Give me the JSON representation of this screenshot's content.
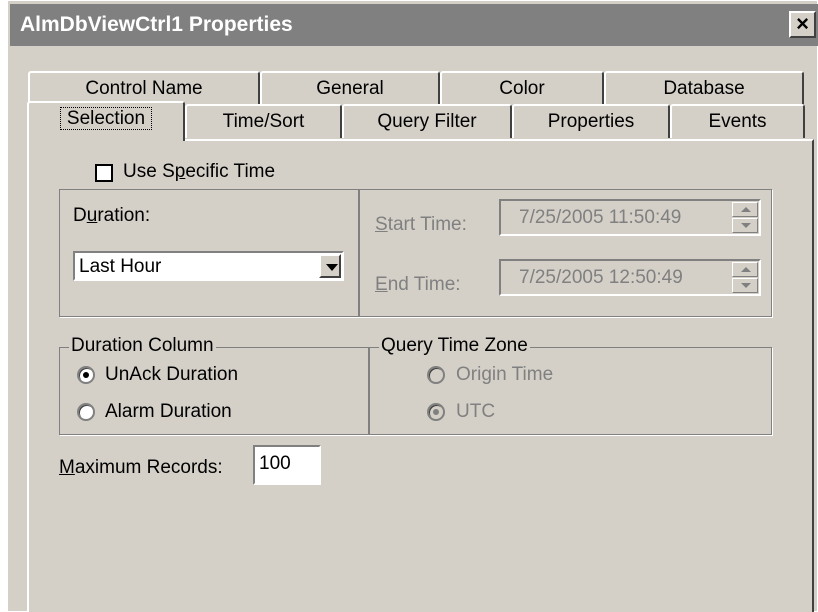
{
  "window": {
    "title": "AlmDbViewCtrl1 Properties",
    "close_glyph": "×"
  },
  "tabs": {
    "row1": [
      "Control Name",
      "General",
      "Color",
      "Database"
    ],
    "row2": [
      "Selection",
      "Time/Sort",
      "Query Filter",
      "Properties",
      "Events"
    ],
    "active": "Selection"
  },
  "use_specific_time": {
    "label_pre": "Use S",
    "label_u": "p",
    "label_post": "ecific Time",
    "checked": false
  },
  "duration": {
    "label_pre": "D",
    "label_u": "u",
    "label_post": "ration:",
    "value": "Last Hour"
  },
  "start_time": {
    "label_u": "S",
    "label_post": "tart Time:",
    "value": "7/25/2005 11:50:49"
  },
  "end_time": {
    "label_u": "E",
    "label_post": "nd Time:",
    "value": "7/25/2005 12:50:49"
  },
  "duration_column": {
    "legend": "Duration Column",
    "options": [
      "UnAck Duration",
      "Alarm Duration"
    ],
    "selected": "UnAck Duration"
  },
  "query_time_zone": {
    "legend": "Query Time Zone",
    "options": [
      "Origin Time",
      "UTC"
    ],
    "selected": "UTC"
  },
  "maximum_records": {
    "label_u": "M",
    "label_post": "aximum Records:",
    "value": "100"
  },
  "colors": {
    "face": "#d4d0c8",
    "titlebar": "#808080",
    "disabled_text": "#808080"
  }
}
